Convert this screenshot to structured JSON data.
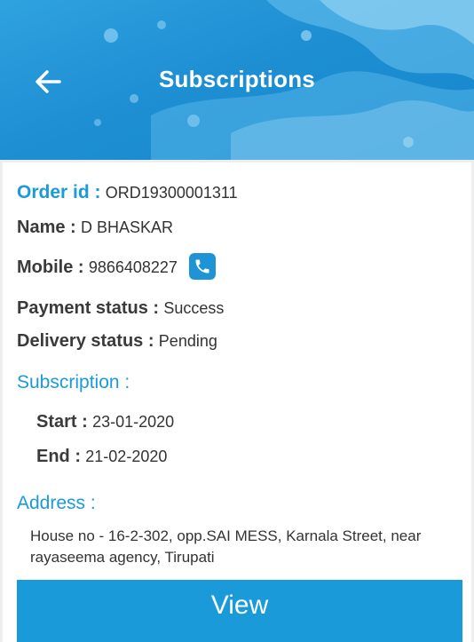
{
  "header": {
    "title": "Subscriptions",
    "back_icon": "arrow-left-icon",
    "background_color": "#1e8fd3"
  },
  "order": {
    "order_id_label": "Order id :",
    "order_id_value": "ORD19300001311",
    "name_label": "Name :",
    "name_value": "D BHASKAR",
    "mobile_label": "Mobile :",
    "mobile_value": "9866408227",
    "phone_icon": "phone-icon",
    "payment_label": "Payment status :",
    "payment_value": "Success",
    "delivery_label": "Delivery status :",
    "delivery_value": "Pending"
  },
  "subscription": {
    "label": "Subscription :",
    "start_label": "Start :",
    "start_value": "23-01-2020",
    "end_label": "End :",
    "end_value": "21-02-2020"
  },
  "address": {
    "label": "Address :",
    "value": "House no - 16-2-302, opp.SAI MESS, Karnala Street, near rayaseema agency, Tirupati"
  },
  "actions": {
    "view_label": "View"
  },
  "colors": {
    "accent": "#1a9ad9",
    "header": "#1e8fd3"
  }
}
